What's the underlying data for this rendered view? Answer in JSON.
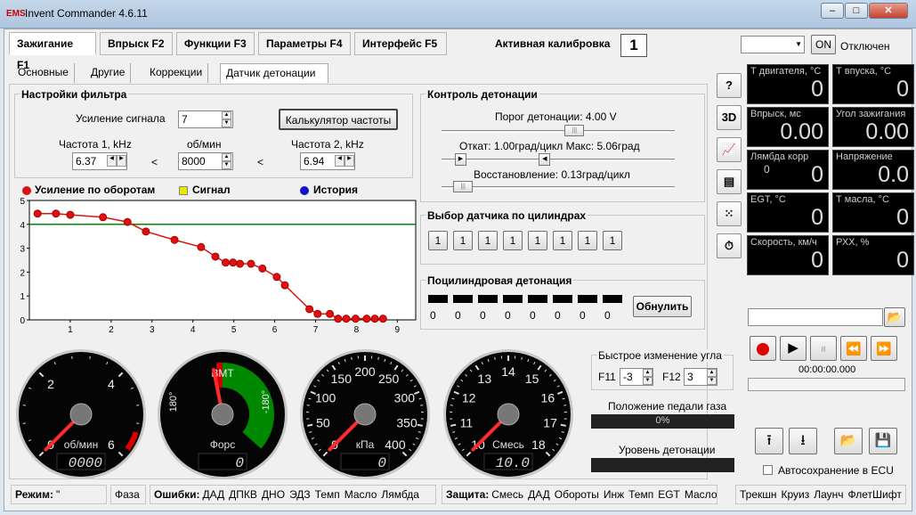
{
  "window": {
    "title": "Invent Commander 4.6.11",
    "logo": "EMS"
  },
  "tabs": [
    {
      "label": "Зажигание F1",
      "active": true
    },
    {
      "label": "Впрыск F2"
    },
    {
      "label": "Функции F3"
    },
    {
      "label": "Параметры F4"
    },
    {
      "label": "Интерфейс F5"
    }
  ],
  "calibration": {
    "label": "Активная калибровка",
    "value": "1"
  },
  "connection": {
    "on_label": "ON",
    "status": "Отключен"
  },
  "subtabs": [
    {
      "label": "Основные"
    },
    {
      "label": "Другие"
    },
    {
      "label": "Коррекции"
    },
    {
      "label": "Датчик детонации",
      "active": true
    }
  ],
  "filter": {
    "title": "Настройки фильтра",
    "gain_label": "Усиление сигнала",
    "gain_value": "7",
    "calc_button": "Калькулятор частоты",
    "freq1_label": "Частота  1, kHz",
    "freq1_value": "6.37",
    "rpm_label": "об/мин",
    "rpm_value": "8000",
    "freq2_label": "Частота 2, kHz",
    "freq2_value": "6.94",
    "lt": "<"
  },
  "knock_control": {
    "title": "Контроль детонации",
    "threshold_label": "Порог детонации: 4.00 V",
    "threshold_pos": 0.57,
    "retard_label": "Откат: 1.00град/цикл Макс: 5.06град",
    "retard_pos": 0.08,
    "retard_max_pos": 0.44,
    "recovery_label": "Восстановление: 0.13град/цикл",
    "recovery_pos": 0.05
  },
  "sensor_select": {
    "title": "Выбор датчика по цилиндрах",
    "values": [
      "1",
      "1",
      "1",
      "1",
      "1",
      "1",
      "1",
      "1"
    ]
  },
  "cyl_knock": {
    "title": "Поцилиндровая детонация",
    "values": [
      "0",
      "0",
      "0",
      "0",
      "0",
      "0",
      "0",
      "0"
    ],
    "reset_button": "Обнулить"
  },
  "legend": {
    "gain": "Усиление по оборотам",
    "signal": "Сигнал",
    "history": "История"
  },
  "colors": {
    "gain": "#dd1111",
    "signal": "#e8e800",
    "history": "#1111cc",
    "threshold": "#008800",
    "gauge_green": "#008800"
  },
  "chart_data": {
    "type": "line",
    "series": [
      {
        "name": "Усиление по оборотам",
        "x": [
          0.2,
          0.65,
          1,
          1.8,
          2.4,
          2.85,
          3.55,
          4.2,
          4.55,
          4.8,
          4.98,
          5.15,
          5.42,
          5.7,
          6.05,
          6.25,
          6.85,
          7.05,
          7.35,
          7.55,
          7.75,
          7.98,
          8.25,
          8.45,
          8.65
        ],
        "values": [
          4.45,
          4.45,
          4.4,
          4.3,
          4.1,
          3.7,
          3.35,
          3.05,
          2.65,
          2.4,
          2.4,
          2.35,
          2.35,
          2.15,
          1.8,
          1.45,
          0.45,
          0.25,
          0.25,
          0.05,
          0.05,
          0.05,
          0.05,
          0.05,
          0.05
        ]
      }
    ],
    "threshold": 4.0,
    "xticks": [
      "1",
      "2",
      "3",
      "4",
      "5",
      "6",
      "7",
      "8",
      "9"
    ],
    "yticks": [
      "0",
      "1",
      "2",
      "3",
      "4",
      "5"
    ],
    "ylim": [
      0,
      5
    ],
    "xlim": [
      0,
      9.45
    ],
    "grid": false
  },
  "gauges": [
    {
      "ticks": [
        "0",
        "2",
        "4",
        "6"
      ],
      "unit": "об/мин",
      "digital": "0000",
      "needle": 0.0
    },
    {
      "top": "BMT",
      "left": "180°",
      "right": "-180°",
      "unit": "Форс",
      "digital": "0",
      "needle": 0.5
    },
    {
      "ticks": [
        "0",
        "50",
        "100",
        "150",
        "200",
        "250",
        "300",
        "350",
        "400"
      ],
      "unit": "кПа",
      "digital": "0",
      "needle": 0.0
    },
    {
      "ticks": [
        "10",
        "11",
        "12",
        "13",
        "14",
        "15",
        "16",
        "17",
        "18"
      ],
      "unit": "Смесь",
      "digital": "10.0",
      "needle": 0.0
    }
  ],
  "quick_angle": {
    "title": "Быстрое изменение угла",
    "f11_label": "F11",
    "f11_value": "-3",
    "f12_label": "F12",
    "f12_value": "3"
  },
  "pedal": {
    "label": "Положение педали газа",
    "value": "0%"
  },
  "knock_level": {
    "label": "Уровень детонации"
  },
  "side_buttons": [
    {
      "label": "?",
      "icon": "help-icon"
    },
    {
      "label": "3D",
      "icon": "3d-icon"
    },
    {
      "label": "📈",
      "icon": "trend-icon"
    },
    {
      "label": "▤",
      "icon": "window-icon"
    },
    {
      "label": "⁙",
      "icon": "grid-icon"
    },
    {
      "label": "⏱",
      "icon": "stopwatch-icon"
    }
  ],
  "sensors": [
    {
      "label": "Т двигателя, °C",
      "value": "0"
    },
    {
      "label": "Т впуска, °C",
      "value": "0"
    },
    {
      "label": "Впрыск, мс",
      "value": "0.00"
    },
    {
      "label": "Угол зажигания",
      "value": "0.00"
    },
    {
      "label": "Лямбда корр",
      "value": "0",
      "sub": "0"
    },
    {
      "label": "Напряжение",
      "value": "0.0"
    },
    {
      "label": "EGT, °C",
      "value": "0"
    },
    {
      "label": "Т масла, °C",
      "value": "0"
    },
    {
      "label": "Скорость, км/ч",
      "value": "0"
    },
    {
      "label": "РХХ, %",
      "value": "0"
    }
  ],
  "recorder": {
    "time": "00:00:00.000",
    "autosave_label": "Автосохранение в ECU"
  },
  "status": {
    "mode_label": "Режим:",
    "mode_value": "\"",
    "phase": "Фаза",
    "errors_label": "Ошибки:",
    "errors": [
      "ДАД",
      "ДПКВ",
      "ДНО",
      "ЭДЗ",
      "Темп",
      "Масло",
      "Лямбда"
    ],
    "protection_label": "Защита:",
    "protection": [
      "Смесь",
      "ДАД",
      "Обороты",
      "Инж",
      "Темп",
      "EGT",
      "Масло"
    ],
    "extra": [
      "Трекшн",
      "Круиз",
      "Лаунч",
      "ФлетШифт"
    ]
  }
}
